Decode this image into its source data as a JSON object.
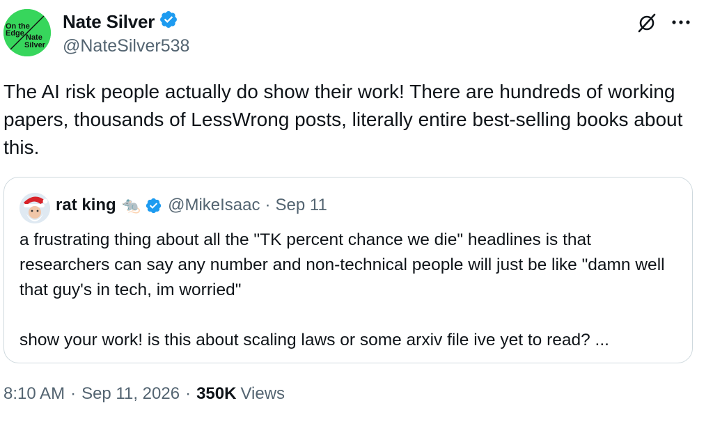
{
  "author": {
    "name": "Nate Silver",
    "handle": "@NateSilver538",
    "avatar_text": "On the Edge Nate Silver",
    "avatar_color": "#37d65c",
    "verified_color": "#1d9bf0"
  },
  "icons": {
    "grok": "grok-icon",
    "more": "more-icon",
    "verified": "verified-badge-icon",
    "rat": "rat-emoji"
  },
  "tweet": {
    "text": "The AI risk people actually do show their work! There are hundreds of working papers, thousands of LessWrong posts, literally entire best-selling books about this."
  },
  "quote": {
    "name": "rat king",
    "emoji": "🐀",
    "handle": "@MikeIsaac",
    "separator": "·",
    "date": "Sep 11",
    "text_lines": [
      "a frustrating thing about all the \"TK percent chance we die\" headlines is that researchers can say any number and non-technical people will just be like \"damn well that guy's in tech, im worried\"",
      "show your work! is this about scaling laws or some arxiv file ive yet to read? ..."
    ]
  },
  "meta": {
    "time": "8:10 AM",
    "separator": "·",
    "date": "Sep 11, 2026",
    "views_count": "350K",
    "views_label": "Views"
  }
}
